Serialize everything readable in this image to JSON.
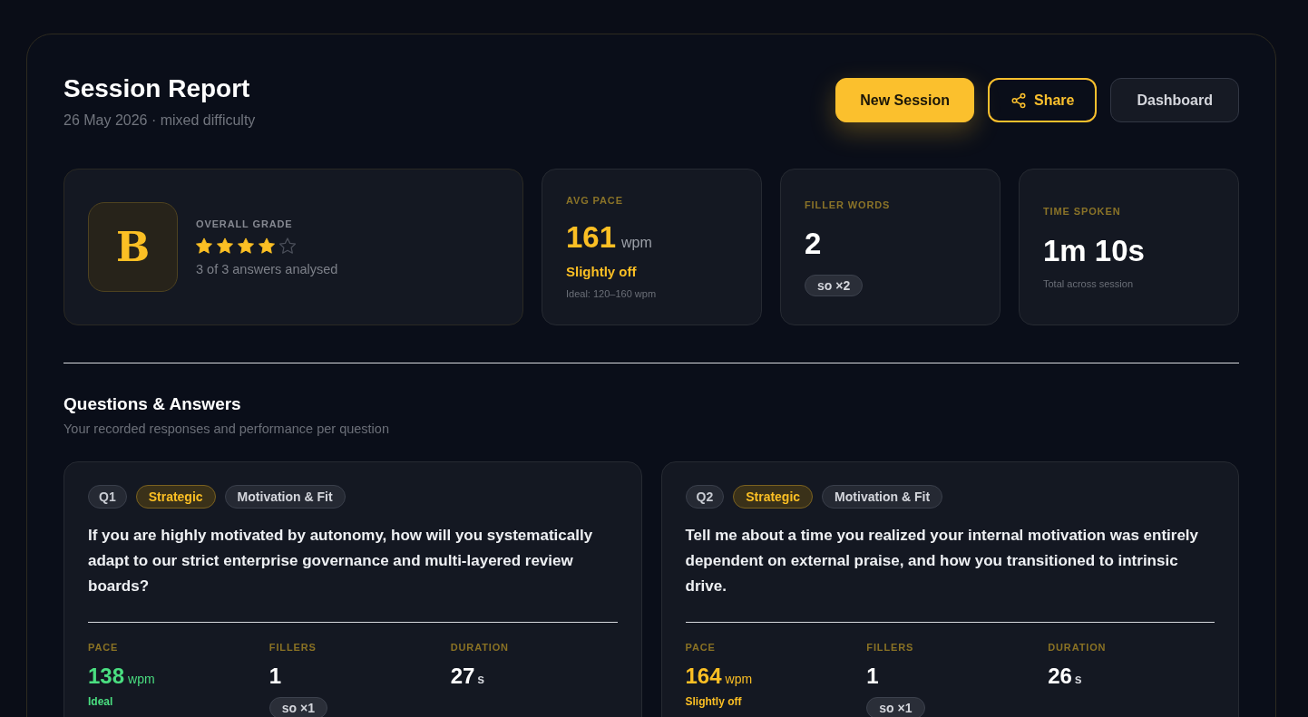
{
  "header": {
    "title": "Session Report",
    "subtitle": "26 May 2026 · mixed difficulty",
    "actions": [
      {
        "label": "New Session",
        "kind": "primary"
      },
      {
        "label": "Share",
        "kind": "share"
      },
      {
        "label": "Dashboard",
        "kind": "secondary"
      }
    ]
  },
  "overall": {
    "grade": "B",
    "label": "OVERALL GRADE",
    "stars": 4,
    "caption": "3 of 3 answers analysed"
  },
  "stats": [
    {
      "kind": "pace",
      "label": "AVG PACE",
      "value": "161",
      "unit": "wpm",
      "status": "Slightly off",
      "color": "#fbbf24",
      "note": "Ideal: 120–160 wpm"
    },
    {
      "kind": "fillers",
      "label": "FILLER WORDS",
      "value": "2",
      "chips": [
        "so ×2"
      ]
    },
    {
      "kind": "time",
      "label": "TIME SPOKEN",
      "value": "1m 10s",
      "note": "Total across session"
    }
  ],
  "questions_section": {
    "title": "Questions & Answers",
    "subtitle": "Your recorded responses and performance per question",
    "questions": [
      {
        "tags": [
          {
            "kind": "number",
            "label": "Q1"
          },
          {
            "kind": "difficulty",
            "label": "Strategic"
          },
          {
            "kind": "category",
            "label": "Motivation & Fit"
          }
        ],
        "text": "If you are highly motivated by autonomy, how will you systematically adapt to our strict enterprise governance and multi-layered review boards?",
        "metrics": [
          {
            "kind": "pace",
            "label": "PACE",
            "value": "138",
            "unit": "wpm",
            "status": "Ideal",
            "color": "#4ade80"
          },
          {
            "kind": "fillers",
            "label": "FILLERS",
            "value": "1",
            "chips": [
              "so ×1"
            ]
          },
          {
            "kind": "duration",
            "label": "DURATION",
            "value": "27",
            "unit": "s"
          }
        ]
      },
      {
        "tags": [
          {
            "kind": "number",
            "label": "Q2"
          },
          {
            "kind": "difficulty",
            "label": "Strategic"
          },
          {
            "kind": "category",
            "label": "Motivation & Fit"
          }
        ],
        "text": "Tell me about a time you realized your internal motivation was entirely dependent on external praise, and how you transitioned to intrinsic drive.",
        "metrics": [
          {
            "kind": "pace",
            "label": "PACE",
            "value": "164",
            "unit": "wpm",
            "status": "Slightly off",
            "color": "#fbbf24"
          },
          {
            "kind": "fillers",
            "label": "FILLERS",
            "value": "1",
            "chips": [
              "so ×1"
            ]
          },
          {
            "kind": "duration",
            "label": "DURATION",
            "value": "26",
            "unit": "s"
          }
        ]
      }
    ]
  }
}
